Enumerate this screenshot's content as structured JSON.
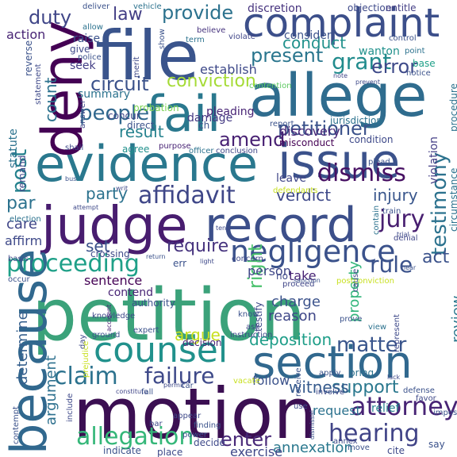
{
  "words": [
    {
      "text": "petition",
      "color": "#3ba27a"
    },
    {
      "text": "motion",
      "color": "#3b0f52"
    },
    {
      "text": "judge",
      "color": "#481d6f"
    },
    {
      "text": "file",
      "color": "#3a548c"
    },
    {
      "text": "allege",
      "color": "#2f6c8e"
    },
    {
      "text": "record",
      "color": "#3c4f8a"
    },
    {
      "text": "evidence",
      "color": "#2a788e"
    },
    {
      "text": "complaint",
      "color": "#3c4f8a"
    },
    {
      "text": "section",
      "color": "#31688e"
    },
    {
      "text": "because",
      "color": "#31688e"
    },
    {
      "text": "deny",
      "color": "#440154"
    },
    {
      "text": "fail",
      "color": "#2a788e"
    },
    {
      "text": "issue",
      "color": "#3b528b"
    },
    {
      "text": "counsel",
      "color": "#21918c"
    },
    {
      "text": "negligence",
      "color": "#3b528b"
    },
    {
      "text": "proceeding",
      "color": "#1fa088"
    },
    {
      "text": "affidavit",
      "color": "#3f4788"
    },
    {
      "text": "dismiss",
      "color": "#471063"
    },
    {
      "text": "attorney",
      "color": "#482475"
    },
    {
      "text": "hearing",
      "color": "#414487"
    },
    {
      "text": "allegation",
      "color": "#35b779"
    },
    {
      "text": "testimony",
      "color": "#2c728e"
    },
    {
      "text": "petitioner",
      "color": "#3b528b"
    },
    {
      "text": "grant",
      "color": "#228c8d"
    },
    {
      "text": "present",
      "color": "#2a768e"
    },
    {
      "text": "provide",
      "color": "#2c728e"
    },
    {
      "text": "law",
      "color": "#433e85"
    },
    {
      "text": "duty",
      "color": "#404688"
    },
    {
      "text": "people",
      "color": "#31688e"
    },
    {
      "text": "circuit",
      "color": "#3b528b"
    },
    {
      "text": "amend",
      "color": "#482173"
    },
    {
      "text": "claim",
      "color": "#2c728e"
    },
    {
      "text": "failure",
      "color": "#3e4989"
    },
    {
      "text": "matter",
      "color": "#39558c"
    },
    {
      "text": "jury",
      "color": "#481f70"
    },
    {
      "text": "rule",
      "color": "#3b528b"
    },
    {
      "text": "conviction",
      "color": "#a5db36"
    },
    {
      "text": "conduct",
      "color": "#21918c"
    },
    {
      "text": "error",
      "color": "#3e4a89"
    },
    {
      "text": "require",
      "color": "#46337e"
    },
    {
      "text": "deposition",
      "color": "#1f9e89"
    },
    {
      "text": "support",
      "color": "#2a788e"
    },
    {
      "text": "enter",
      "color": "#482878"
    },
    {
      "text": "post",
      "color": "#26828e"
    },
    {
      "text": "injury",
      "color": "#39568c"
    },
    {
      "text": "verdict",
      "color": "#3e4989"
    },
    {
      "text": "argument",
      "color": "#2d708e"
    },
    {
      "text": "witness",
      "color": "#375b8d"
    },
    {
      "text": "annexation",
      "color": "#2a788e"
    },
    {
      "text": "act",
      "color": "#3b528b"
    },
    {
      "text": "result",
      "color": "#26828e"
    },
    {
      "text": "party",
      "color": "#2c728e"
    },
    {
      "text": "count",
      "color": "#2c728e"
    },
    {
      "text": "set",
      "color": "#3b528b"
    },
    {
      "text": "right",
      "color": "#4ac16d"
    },
    {
      "text": "argue",
      "color": "#c8e020"
    },
    {
      "text": "determine",
      "color": "#355f8d"
    },
    {
      "text": "review",
      "color": "#2a788e"
    },
    {
      "text": "property",
      "color": "#31b57b"
    },
    {
      "text": "discovery",
      "color": "#482677"
    },
    {
      "text": "charge",
      "color": "#3b528b"
    },
    {
      "text": "reason",
      "color": "#3f4788"
    },
    {
      "text": "sentence",
      "color": "#440154"
    },
    {
      "text": "care",
      "color": "#404688"
    },
    {
      "text": "affirm",
      "color": "#3e4989"
    },
    {
      "text": "par",
      "color": "#2c728e"
    },
    {
      "text": "establish",
      "color": "#3e4989"
    },
    {
      "text": "action",
      "color": "#482475"
    },
    {
      "text": "consider",
      "color": "#3b528b"
    },
    {
      "text": "summary",
      "color": "#2c728e"
    },
    {
      "text": "damage",
      "color": "#443983"
    },
    {
      "text": "person",
      "color": "#3f4788"
    },
    {
      "text": "contend",
      "color": "#482475"
    },
    {
      "text": "follow",
      "color": "#3b528b"
    },
    {
      "text": "take",
      "color": "#482475"
    },
    {
      "text": "request",
      "color": "#2c728e"
    },
    {
      "text": "relief",
      "color": "#26828e"
    },
    {
      "text": "jurisdiction",
      "color": "#2c728e"
    },
    {
      "text": "misconduct",
      "color": "#440154"
    },
    {
      "text": "exercise",
      "color": "#3f4788"
    },
    {
      "text": "decision",
      "color": "#482475"
    },
    {
      "text": "concern",
      "color": "#3e4989"
    },
    {
      "text": "violation",
      "color": "#433e85"
    },
    {
      "text": "remand",
      "color": "#404688"
    },
    {
      "text": "statute",
      "color": "#2c728e"
    },
    {
      "text": "circumstance",
      "color": "#2c728e"
    },
    {
      "text": "wanton",
      "color": "#21918c"
    },
    {
      "text": "report",
      "color": "#3b528b"
    },
    {
      "text": "leave",
      "color": "#404688"
    },
    {
      "text": "answer",
      "color": "#3e4989"
    },
    {
      "text": "seek",
      "color": "#433e85"
    },
    {
      "text": "raise",
      "color": "#3b528b"
    },
    {
      "text": "condition",
      "color": "#3e4989"
    },
    {
      "text": "discretion",
      "color": "#46337e"
    },
    {
      "text": "objection",
      "color": "#3e4989"
    },
    {
      "text": "entitle",
      "color": "#433e85"
    },
    {
      "text": "deliver",
      "color": "#3b528b"
    },
    {
      "text": "vehicle",
      "color": "#2c728e"
    },
    {
      "text": "believe",
      "color": "#46337e"
    },
    {
      "text": "term",
      "color": "#2c728e"
    },
    {
      "text": "give",
      "color": "#3e4989"
    },
    {
      "text": "police",
      "color": "#3b528b"
    },
    {
      "text": "allow",
      "color": "#2c728e"
    },
    {
      "text": "merit",
      "color": "#3e4989"
    },
    {
      "text": "show",
      "color": "#3b528b"
    },
    {
      "text": "violate",
      "color": "#404688"
    },
    {
      "text": "control",
      "color": "#3b528b"
    },
    {
      "text": "point",
      "color": "#2c728e"
    },
    {
      "text": "base",
      "color": "#1fa088"
    },
    {
      "text": "notice",
      "color": "#3b528b"
    },
    {
      "text": "procedure",
      "color": "#2c728e"
    },
    {
      "text": "plead",
      "color": "#3b528b"
    },
    {
      "text": "pleading",
      "color": "#482475"
    },
    {
      "text": "contention",
      "color": "#5ec962"
    },
    {
      "text": "prevent",
      "color": "#3e4989"
    },
    {
      "text": "note",
      "color": "#404688"
    },
    {
      "text": "concur",
      "color": "#404688"
    },
    {
      "text": "probation",
      "color": "#7ad151"
    },
    {
      "text": "direct",
      "color": "#3b528b"
    },
    {
      "text": "agree",
      "color": "#21918c"
    },
    {
      "text": "purpose",
      "color": "#482475"
    },
    {
      "text": "officer",
      "color": "#2c728e"
    },
    {
      "text": "conclusion",
      "color": "#404688"
    },
    {
      "text": "shall",
      "color": "#3e4989"
    },
    {
      "text": "bus",
      "color": "#3b528b"
    },
    {
      "text": "writ",
      "color": "#3e4989"
    },
    {
      "text": "defendants",
      "color": "#c8e020"
    },
    {
      "text": "election",
      "color": "#2c728e"
    },
    {
      "text": "basis",
      "color": "#3e4989"
    },
    {
      "text": "occur",
      "color": "#3b528b"
    },
    {
      "text": "crossing",
      "color": "#3e4989"
    },
    {
      "text": "knowledge",
      "color": "#3e4989"
    },
    {
      "text": "authority",
      "color": "#3b528b"
    },
    {
      "text": "proceed",
      "color": "#404688"
    },
    {
      "text": "sanction",
      "color": "#3b528b"
    },
    {
      "text": "postconviction",
      "color": "#c8e020"
    },
    {
      "text": "testify",
      "color": "#3e4989"
    },
    {
      "text": "contain",
      "color": "#2c728e"
    },
    {
      "text": "train",
      "color": "#3b528b"
    },
    {
      "text": "denial",
      "color": "#404688"
    },
    {
      "text": "trial",
      "color": "#3e4989"
    },
    {
      "text": "hear",
      "color": "#3b528b"
    },
    {
      "text": "cause",
      "color": "#404688"
    },
    {
      "text": "represent",
      "color": "#3e4989"
    },
    {
      "text": "know",
      "color": "#3b528b"
    },
    {
      "text": "ask",
      "color": "#404688"
    },
    {
      "text": "instruction",
      "color": "#3e4989"
    },
    {
      "text": "prove",
      "color": "#3b528b"
    },
    {
      "text": "view",
      "color": "#2c728e"
    },
    {
      "text": "expert",
      "color": "#3b528b"
    },
    {
      "text": "accident",
      "color": "#482475"
    },
    {
      "text": "day",
      "color": "#3e4989"
    },
    {
      "text": "ground",
      "color": "#3b528b"
    },
    {
      "text": "prejudice",
      "color": "#c8e020"
    },
    {
      "text": "constitute",
      "color": "#404688"
    },
    {
      "text": "fall",
      "color": "#3b528b"
    },
    {
      "text": "permit",
      "color": "#3e4989"
    },
    {
      "text": "car",
      "color": "#3b528b"
    },
    {
      "text": "vacate",
      "color": "#c8e020"
    },
    {
      "text": "involve",
      "color": "#3e4989"
    },
    {
      "text": "apply",
      "color": "#3b528b"
    },
    {
      "text": "bring",
      "color": "#2c728e"
    },
    {
      "text": "lack",
      "color": "#3e4989"
    },
    {
      "text": "defense",
      "color": "#3b528b"
    },
    {
      "text": "favor",
      "color": "#3e4989"
    },
    {
      "text": "impose",
      "color": "#3b528b"
    },
    {
      "text": "include",
      "color": "#3e4989"
    },
    {
      "text": "contempt",
      "color": "#3b528b"
    },
    {
      "text": "appear",
      "color": "#3e4989"
    },
    {
      "text": "finding",
      "color": "#3b528b"
    },
    {
      "text": "bar",
      "color": "#3e4989"
    },
    {
      "text": "power",
      "color": "#3b528b"
    },
    {
      "text": "decide",
      "color": "#3e4989"
    },
    {
      "text": "indicate",
      "color": "#3b528b"
    },
    {
      "text": "place",
      "color": "#3e4989"
    },
    {
      "text": "receive",
      "color": "#3b528b"
    },
    {
      "text": "use",
      "color": "#3e4989"
    },
    {
      "text": "dismissal",
      "color": "#3b528b"
    },
    {
      "text": "annex",
      "color": "#3e4989"
    },
    {
      "text": "move",
      "color": "#3b528b"
    },
    {
      "text": "cite",
      "color": "#3e4989"
    },
    {
      "text": "say",
      "color": "#3b528b"
    },
    {
      "text": "reverse",
      "color": "#3b528b"
    },
    {
      "text": "statement",
      "color": "#3e4989"
    },
    {
      "text": "attempt",
      "color": "#3e4989"
    },
    {
      "text": "return",
      "color": "#3b528b"
    },
    {
      "text": "light",
      "color": "#3e4989"
    },
    {
      "text": "err",
      "color": "#3b528b"
    },
    {
      "text": "no",
      "color": "#3e4989"
    },
    {
      "text": "ch",
      "color": "#3b528b"
    },
    {
      "text": "tend",
      "color": "#3e4989"
    }
  ]
}
